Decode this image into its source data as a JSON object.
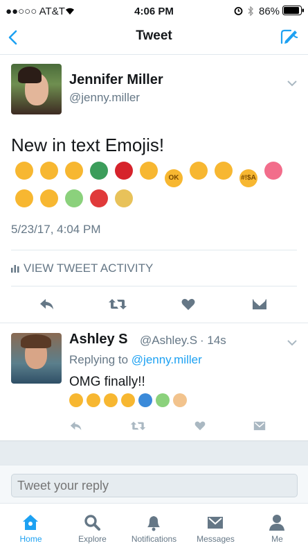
{
  "status_bar": {
    "carrier": "●●○○○ AT&T",
    "time": "4:06 PM",
    "battery": "86%"
  },
  "nav": {
    "title": "Tweet"
  },
  "main_tweet": {
    "name": "Jennifer Miller",
    "handle": "@jenny.miller",
    "text": "New in text Emojis!",
    "timestamp": "5/23/17, 4:04 PM",
    "activity_label": "VIEW TWEET ACTIVITY",
    "emojis": [
      {
        "icon": "smiling-face-with-hearts-icon",
        "color": "#f7b731",
        "label": ""
      },
      {
        "icon": "exploding-head-icon",
        "color": "#f7b731",
        "label": ""
      },
      {
        "icon": "zany-face-icon",
        "color": "#f7b731",
        "label": ""
      },
      {
        "icon": "coffee-cup-icon",
        "color": "#3c9d5b",
        "label": ""
      },
      {
        "icon": "soda-can-icon",
        "color": "#d6232b",
        "label": ""
      },
      {
        "icon": "partying-face-icon",
        "color": "#f7b731",
        "label": ""
      },
      {
        "icon": "ok-face-icon",
        "color": "#f7b731",
        "label": "OK"
      },
      {
        "icon": "shushing-face-icon",
        "color": "#f7b731",
        "label": ""
      },
      {
        "icon": "hand-over-mouth-icon",
        "color": "#f7b731",
        "label": ""
      },
      {
        "icon": "cursing-face-icon",
        "color": "#f7b731",
        "label": "#!$A"
      },
      {
        "icon": "vomiting-face-icon",
        "color": "#f26d8b",
        "label": ""
      },
      {
        "icon": "woozy-face-icon",
        "color": "#f7b731",
        "label": ""
      },
      {
        "icon": "rolling-laughing-icon",
        "color": "#f7b731",
        "label": ""
      },
      {
        "icon": "rainbow-heart-icon",
        "color": "#8bd17c",
        "label": ""
      },
      {
        "icon": "strawberry-icon",
        "color": "#e03a3a",
        "label": ""
      },
      {
        "icon": "potatoes-icon",
        "color": "#e8c25a",
        "label": ""
      }
    ]
  },
  "reply_tweet": {
    "name": "Ashley S",
    "handle": "@Ashley.S",
    "time": "· 14s",
    "replying_prefix": "Replying to ",
    "replying_handle": "@jenny.miller",
    "text": "OMG finally!!",
    "emojis": [
      {
        "icon": "hand-over-mouth-icon",
        "color": "#f7b731"
      },
      {
        "icon": "star-struck-icon",
        "color": "#f7b731"
      },
      {
        "icon": "money-face-icon",
        "color": "#f7b731"
      },
      {
        "icon": "headphones-face-icon",
        "color": "#f7b731"
      },
      {
        "icon": "astronaut-face-icon",
        "color": "#3b8ad9"
      },
      {
        "icon": "rainbow-icon",
        "color": "#8bd17c"
      },
      {
        "icon": "hand-icon",
        "color": "#f2c38d"
      }
    ]
  },
  "reply_input": {
    "placeholder": "Tweet your reply"
  },
  "tab_bar": {
    "items": [
      {
        "label": "Home"
      },
      {
        "label": "Explore"
      },
      {
        "label": "Notifications"
      },
      {
        "label": "Messages"
      },
      {
        "label": "Me"
      }
    ]
  },
  "colors": {
    "accent": "#1da1f2",
    "muted": "#657786",
    "icon_gray": "#8899a6",
    "divider": "#e1e8ed"
  }
}
